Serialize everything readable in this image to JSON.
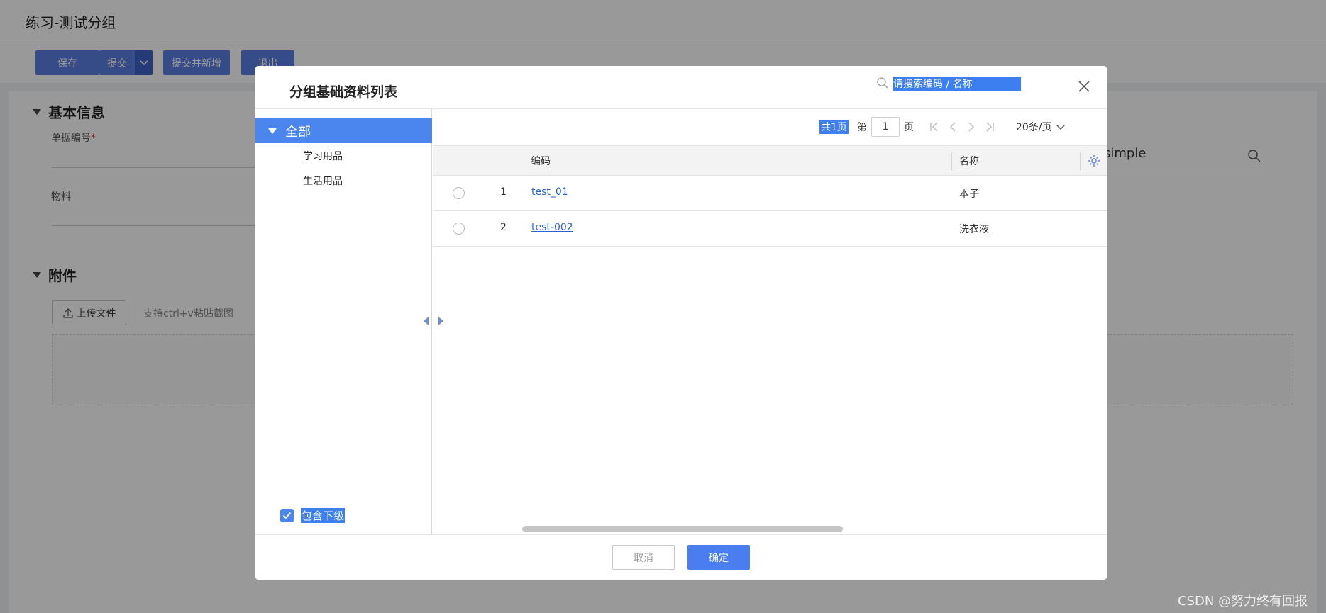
{
  "page": {
    "title": "练习-测试分组",
    "toolbar": {
      "save": "保存",
      "submit": "提交",
      "submit_add": "提交并新增",
      "exit": "退出"
    },
    "basic_section": "基本信息",
    "doc_no_label": "单据编号",
    "required_mark": "*",
    "material_label": "物料",
    "simple_value": "simple",
    "attachment_section": "附件",
    "upload_button": "上传文件",
    "upload_hint": "支持ctrl+v粘贴截图"
  },
  "modal": {
    "title": "分组基础资料列表",
    "search_placeholder": "请搜索编码 / 名称",
    "tree": {
      "root": "全部",
      "children": [
        "学习用品",
        "生活用品"
      ]
    },
    "include_sub_label": "包含下级",
    "include_sub_checked": true,
    "pager": {
      "total": "共1页",
      "prefix": "第",
      "page": "1",
      "suffix": "页",
      "page_size": "20条/页"
    },
    "columns": {
      "code": "编码",
      "name": "名称"
    },
    "rows": [
      {
        "index": "1",
        "code": "test_01",
        "name": "本子"
      },
      {
        "index": "2",
        "code": "test-002",
        "name": "洗衣液"
      }
    ],
    "cancel": "取消",
    "confirm": "确定"
  },
  "colors": {
    "primary": "#4a7df0",
    "overlay": "rgba(0,0,0,0.40)"
  },
  "watermark": "CSDN @努力终有回报"
}
